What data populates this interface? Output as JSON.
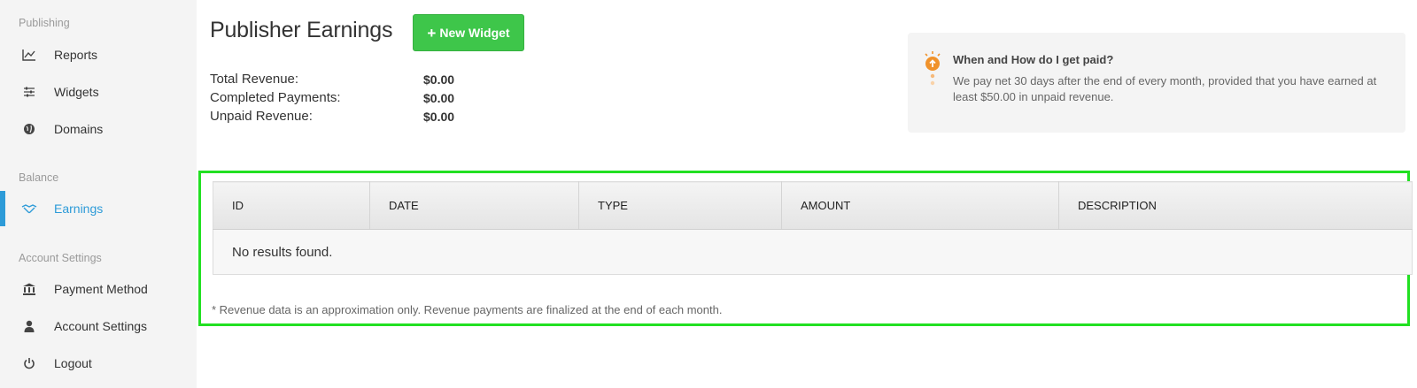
{
  "sidebar": {
    "sections": [
      {
        "label": "Publishing",
        "items": [
          {
            "label": "Reports",
            "icon": "line-chart-icon"
          },
          {
            "label": "Widgets",
            "icon": "sliders-icon"
          },
          {
            "label": "Domains",
            "icon": "globe-icon"
          }
        ]
      },
      {
        "label": "Balance",
        "items": [
          {
            "label": "Earnings",
            "icon": "handshake-icon",
            "active": true
          }
        ]
      },
      {
        "label": "Account Settings",
        "items": [
          {
            "label": "Payment Method",
            "icon": "bank-icon"
          },
          {
            "label": "Account Settings",
            "icon": "user-icon"
          },
          {
            "label": "Logout",
            "icon": "power-icon"
          }
        ]
      }
    ]
  },
  "header": {
    "title": "Publisher Earnings",
    "new_widget_label": "New Widget"
  },
  "summary": [
    {
      "label": "Total Revenue:",
      "value": "$0.00"
    },
    {
      "label": "Completed Payments:",
      "value": "$0.00"
    },
    {
      "label": "Unpaid Revenue:",
      "value": "$0.00"
    }
  ],
  "info": {
    "title": "When and How do I get paid?",
    "text": "We pay net 30 days after the end of every month, provided that you have earned at least $50.00 in unpaid revenue.",
    "icon": "lightbulb-icon"
  },
  "table": {
    "columns": [
      "ID",
      "DATE",
      "TYPE",
      "AMOUNT",
      "DESCRIPTION"
    ],
    "empty_text": "No results found.",
    "footnote": "* Revenue data is an approximation only. Revenue payments are finalized at the end of each month."
  },
  "colors": {
    "accent": "#2d9bd8",
    "button_green": "#3ec64a",
    "highlight_border": "#22e022",
    "info_icon_orange": "#f0922b"
  }
}
